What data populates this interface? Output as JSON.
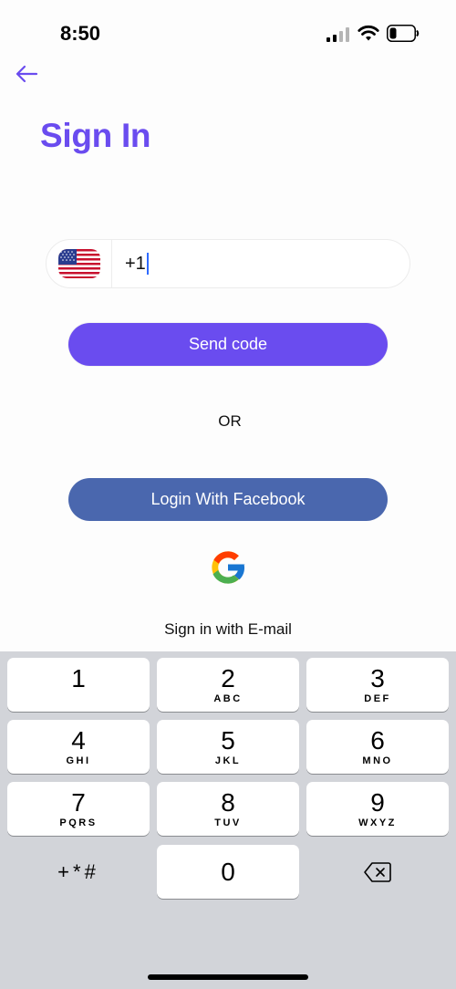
{
  "status_bar": {
    "time": "8:50",
    "icons": [
      "signal-icon",
      "wifi-icon",
      "battery-icon"
    ]
  },
  "header": {
    "back_icon": "arrow-left-icon",
    "title": "Sign In"
  },
  "phone_field": {
    "country_flag": "us-flag-icon",
    "value": "+1"
  },
  "buttons": {
    "send_code": "Send code",
    "or_label": "OR",
    "facebook": "Login With Facebook",
    "google_icon": "google-logo-icon",
    "email": "Sign in with E-mail"
  },
  "keyboard": {
    "keys": [
      {
        "digit": "1",
        "letters": ""
      },
      {
        "digit": "2",
        "letters": "ABC"
      },
      {
        "digit": "3",
        "letters": "DEF"
      },
      {
        "digit": "4",
        "letters": "GHI"
      },
      {
        "digit": "5",
        "letters": "JKL"
      },
      {
        "digit": "6",
        "letters": "MNO"
      },
      {
        "digit": "7",
        "letters": "PQRS"
      },
      {
        "digit": "8",
        "letters": "TUV"
      },
      {
        "digit": "9",
        "letters": "WXYZ"
      },
      {
        "digit": "0",
        "letters": ""
      }
    ],
    "symbols_label": "+*#",
    "delete_icon": "backspace-icon"
  },
  "colors": {
    "accent": "#6a4cef",
    "facebook": "#4a67ae",
    "keyboard_bg": "#d2d4d9"
  }
}
